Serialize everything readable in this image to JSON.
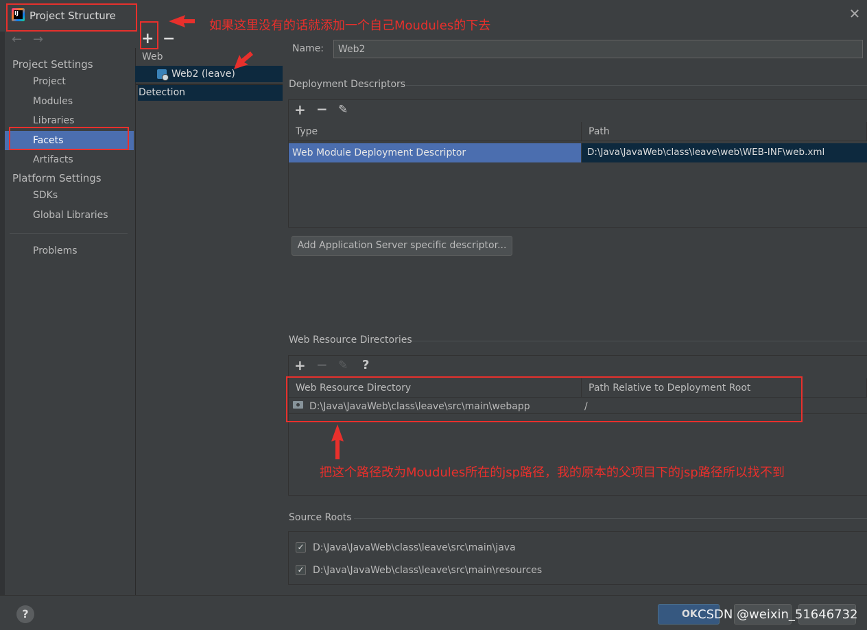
{
  "window": {
    "title": "Project Structure",
    "close_icon": "close-icon"
  },
  "nav": {
    "project_settings_header": "Project Settings",
    "project_settings_items": [
      "Project",
      "Modules",
      "Libraries",
      "Facets",
      "Artifacts"
    ],
    "selected": "Facets",
    "platform_settings_header": "Platform Settings",
    "platform_settings_items": [
      "SDKs",
      "Global Libraries"
    ],
    "problems": "Problems"
  },
  "tree": {
    "add_label": "+",
    "remove_label": "−",
    "group": "Web",
    "facet": "Web2 (leave)",
    "detection": "Detection"
  },
  "facet": {
    "name_label": "Name:",
    "name_value": "Web2"
  },
  "deployment": {
    "title": "Deployment Descriptors",
    "columns": [
      "Type",
      "Path"
    ],
    "rows": [
      {
        "type": "Web Module Deployment Descriptor",
        "path": "D:\\Java\\JavaWeb\\class\\leave\\web\\WEB-INF\\web.xml"
      }
    ],
    "add_server_button": "Add Application Server specific descriptor..."
  },
  "web_resources": {
    "title": "Web Resource Directories",
    "columns": [
      "Web Resource Directory",
      "Path Relative to Deployment Root"
    ],
    "rows": [
      {
        "directory": "D:\\Java\\JavaWeb\\class\\leave\\src\\main\\webapp",
        "relative": "/"
      }
    ],
    "help_label": "?"
  },
  "source_roots": {
    "title": "Source Roots",
    "items": [
      {
        "path": "D:\\Java\\JavaWeb\\class\\leave\\src\\main\\java",
        "checked": true
      },
      {
        "path": "D:\\Java\\JavaWeb\\class\\leave\\src\\main\\resources",
        "checked": true
      }
    ]
  },
  "footer": {
    "help": "?",
    "ok": "OK",
    "watermark": "CSDN @weixin_51646732"
  },
  "annotations": {
    "note_top": "如果这里没有的话就添加一个自己Moudules的下去",
    "note_bottom": "把这个路径改为Moudules所在的jsp路径，我的原本的父项目下的jsp路径所以找不到"
  },
  "colors": {
    "accent_selection": "#4b6eaf",
    "annotation_red": "#e8302c",
    "ok_button": "#365880"
  }
}
